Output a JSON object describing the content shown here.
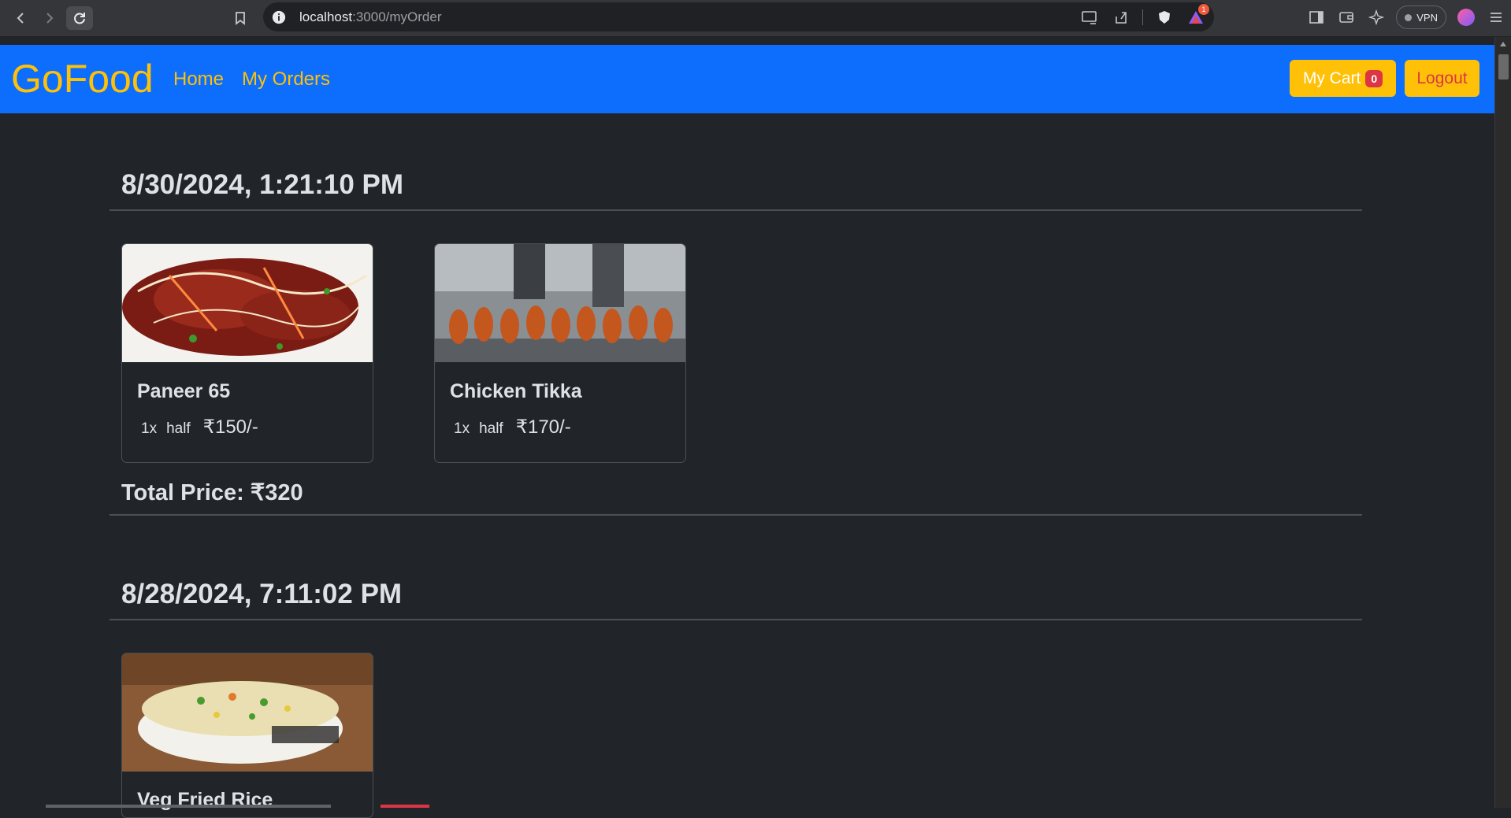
{
  "browser": {
    "url_host": "localhost",
    "url_path": ":3000/myOrder",
    "notification_count": "1",
    "vpn_label": "VPN"
  },
  "navbar": {
    "brand": "GoFood",
    "links": [
      "Home",
      "My Orders"
    ],
    "cart_label": "My Cart",
    "cart_count": "0",
    "logout_label": "Logout"
  },
  "orders": [
    {
      "date": "8/30/2024, 1:21:10 PM",
      "items": [
        {
          "name": "Paneer 65",
          "qty": "1x",
          "size": "half",
          "price": "₹150/-"
        },
        {
          "name": "Chicken Tikka",
          "qty": "1x",
          "size": "half",
          "price": "₹170/-"
        }
      ],
      "total": "Total Price: ₹320"
    },
    {
      "date": "8/28/2024, 7:11:02 PM",
      "items": [
        {
          "name": "Veg Fried Rice",
          "qty": "",
          "size": "",
          "price": ""
        }
      ]
    }
  ],
  "colors": {
    "navbar_bg": "#0d6efd",
    "accent_warning": "#ffc107",
    "danger": "#dc3545",
    "page_bg": "#212529"
  }
}
